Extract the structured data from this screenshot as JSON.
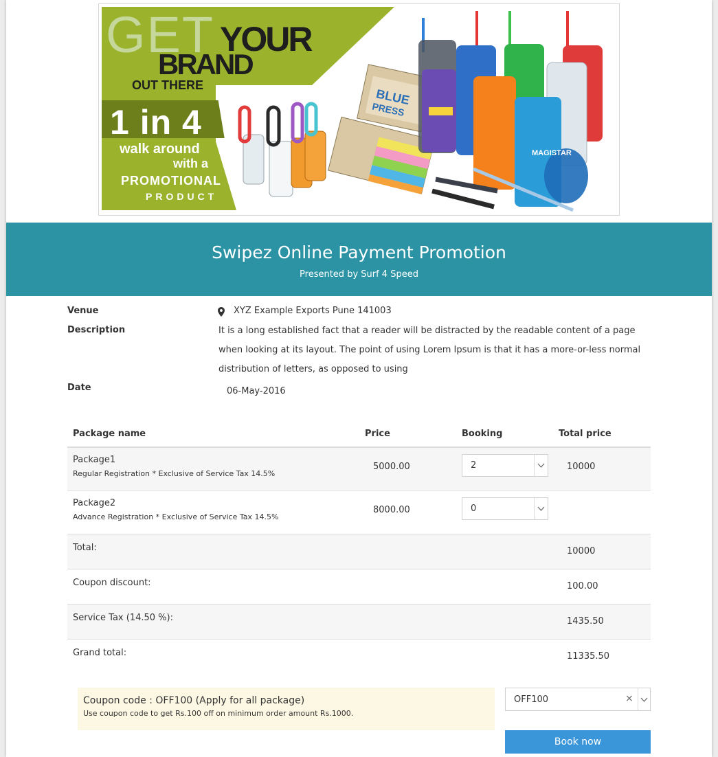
{
  "banner": {
    "get": "GET",
    "your": "YOUR",
    "brand": "BRAND",
    "out_there": "OUT THERE",
    "one_in_four": "1 in 4",
    "walk_around": "walk around",
    "with_a": "with a",
    "promotional": "PROMOTIONAL",
    "product": "PRODUCT",
    "colors": {
      "green": "#9bb22d",
      "dark_green": "#6d7f1b",
      "light_green": "#c5d79a"
    }
  },
  "header": {
    "title": "Swipez Online Payment Promotion",
    "subtitle": "Presented by Surf 4 Speed",
    "background": "#2b93a4"
  },
  "info": {
    "venue_label": "Venue",
    "venue_icon": "map-marker-icon",
    "venue_value": "XYZ Example Exports Pune 141003",
    "description_label": "Description",
    "description_value": "It is a long established fact that a reader will be distracted by the readable content of a page when looking at its layout. The point of using Lorem Ipsum is that it has a more-or-less normal distribution of letters, as opposed to using",
    "date_label": "Date",
    "date_value": "06-May-2016"
  },
  "table": {
    "headers": [
      "Package name",
      "Price",
      "Booking",
      "Total price"
    ],
    "packages": [
      {
        "name": "Package1",
        "note": "Regular Registration * Exclusive of Service Tax 14.5%",
        "price": "5000.00",
        "booking": "2",
        "total": "10000"
      },
      {
        "name": "Package2",
        "note": "Advance Registration * Exclusive of Service Tax 14.5%",
        "price": "8000.00",
        "booking": "0",
        "total": ""
      }
    ],
    "summary": [
      {
        "label": "Total:",
        "value": "10000"
      },
      {
        "label": "Coupon discount:",
        "value": "100.00"
      },
      {
        "label": "Service Tax (14.50 %):",
        "value": "1435.50"
      },
      {
        "label": "Grand total:",
        "value": "11335.50"
      }
    ]
  },
  "coupon": {
    "title": "Coupon code : OFF100 (Apply for all package)",
    "note": "Use coupon code to get Rs.100 off on minimum order amount Rs.1000.",
    "selected": "OFF100",
    "clear_symbol": "×",
    "background": "#fcf8e3"
  },
  "actions": {
    "book_now": "Book now",
    "button_color": "#3b95d9"
  }
}
